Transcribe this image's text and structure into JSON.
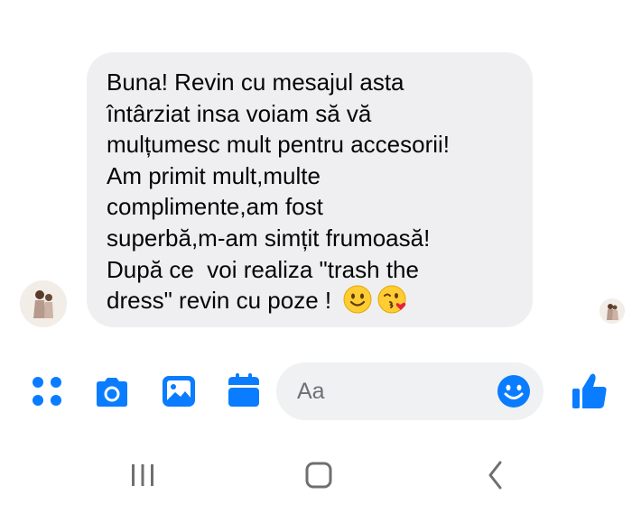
{
  "message": {
    "lines": [
      "Buna! Revin cu mesajul asta",
      "întârziat insa voiam să vă",
      "mulțumesc mult pentru accesorii!",
      "Am primit mult,multe",
      "complimente,am fost",
      "superbă,m-am simțit frumoasă!",
      "După ce  voi realiza \"trash the",
      "dress\" revin cu poze ! "
    ],
    "emojis": [
      "slightly-smiling-face",
      "face-blowing-a-kiss"
    ]
  },
  "composer": {
    "placeholder": "Aa",
    "icons": [
      "menu-dots-icon",
      "camera-icon",
      "gallery-icon",
      "calendar-icon",
      "emoji-icon",
      "thumbs-up-icon"
    ]
  },
  "colors": {
    "accent": "#0a7cff",
    "bubble": "#efeff1",
    "input_bg": "#f0f1f3",
    "text": "#050505",
    "nav_icon": "#6f6f6f"
  },
  "navigation": {
    "icons": [
      "recent-apps-icon",
      "home-icon",
      "back-icon"
    ]
  }
}
